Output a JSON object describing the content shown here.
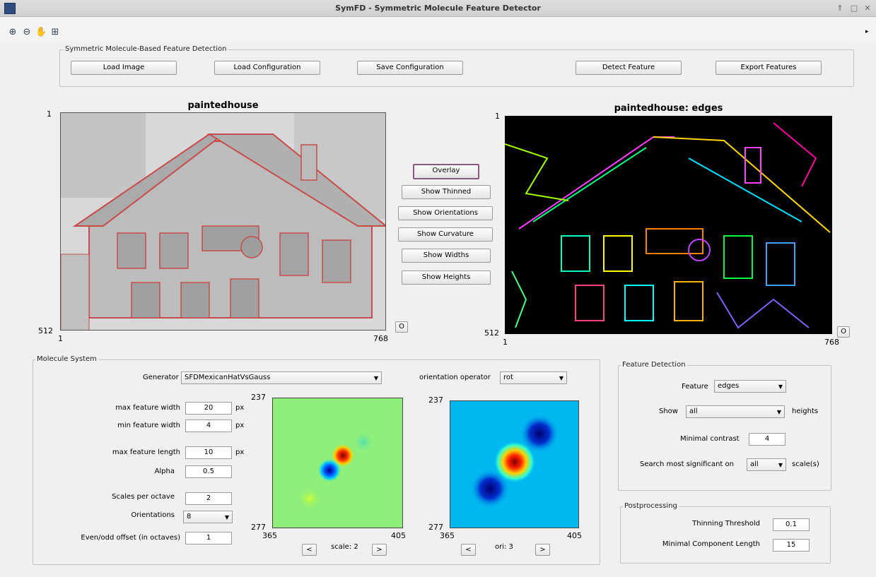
{
  "window": {
    "title": "SymFD - Symmetric Molecule Feature Detector"
  },
  "toolbar": {
    "icons": [
      "zoom-in-icon",
      "zoom-out-icon",
      "pan-icon",
      "data-cursor-icon"
    ]
  },
  "top_panel": {
    "title": "Symmetric Molecule-Based Feature Detection",
    "buttons": [
      "Load Image",
      "Load Configuration",
      "Save Configuration",
      "Detect Feature",
      "Export Features"
    ]
  },
  "left_axes": {
    "title": "paintedhouse",
    "y_top": "1",
    "y_bottom": "512",
    "x_left": "1",
    "x_right": "768",
    "corner_button": "O"
  },
  "right_axes": {
    "title": "paintedhouse: edges",
    "y_top": "1",
    "y_bottom": "512",
    "x_left": "1",
    "x_right": "768",
    "corner_button": "O"
  },
  "view_buttons": {
    "overlay": "Overlay",
    "thinned": "Show Thinned",
    "orientations": "Show Orientations",
    "curvature": "Show Curvature",
    "widths": "Show Widths",
    "heights": "Show Heights"
  },
  "molecule": {
    "title": "Molecule System",
    "generator_label": "Generator",
    "generator_value": "SFDMexicanHatVsGauss",
    "orientation_label": "orientation operator",
    "orientation_value": "rot",
    "max_width_label": "max feature width",
    "max_width_value": "20",
    "min_width_label": "min feature width",
    "min_width_value": "4",
    "max_length_label": "max feature length",
    "max_length_value": "10",
    "unit": "px",
    "alpha_label": "Alpha",
    "alpha_value": "0.5",
    "scales_label": "Scales per  octave",
    "scales_value": "2",
    "orient_label": "Orientations",
    "orient_value": "8",
    "offset_label": "Even/odd offset (in octaves)",
    "offset_value": "1",
    "plot1": {
      "y_top": "237",
      "y_bottom": "277",
      "x_left": "365",
      "x_right": "405",
      "caption": "scale: 2"
    },
    "plot2": {
      "y_top": "237",
      "y_bottom": "277",
      "x_left": "365",
      "x_right": "405",
      "caption": "ori: 3"
    },
    "prev": "<",
    "next": ">"
  },
  "feature_detection": {
    "title": "Feature Detection",
    "feature_label": "Feature",
    "feature_value": "edges",
    "show_label": "Show",
    "show_value": "all",
    "heights_label": "heights",
    "contrast_label": "Minimal contrast",
    "contrast_value": "4",
    "search_label": "Search most significant on",
    "search_value": "all",
    "scales_label": "scale(s)"
  },
  "postprocessing": {
    "title": "Postprocessing",
    "thinning_label": "Thinning Threshold",
    "thinning_value": "0.1",
    "component_label": "Minimal Component Length",
    "component_value": "15"
  }
}
